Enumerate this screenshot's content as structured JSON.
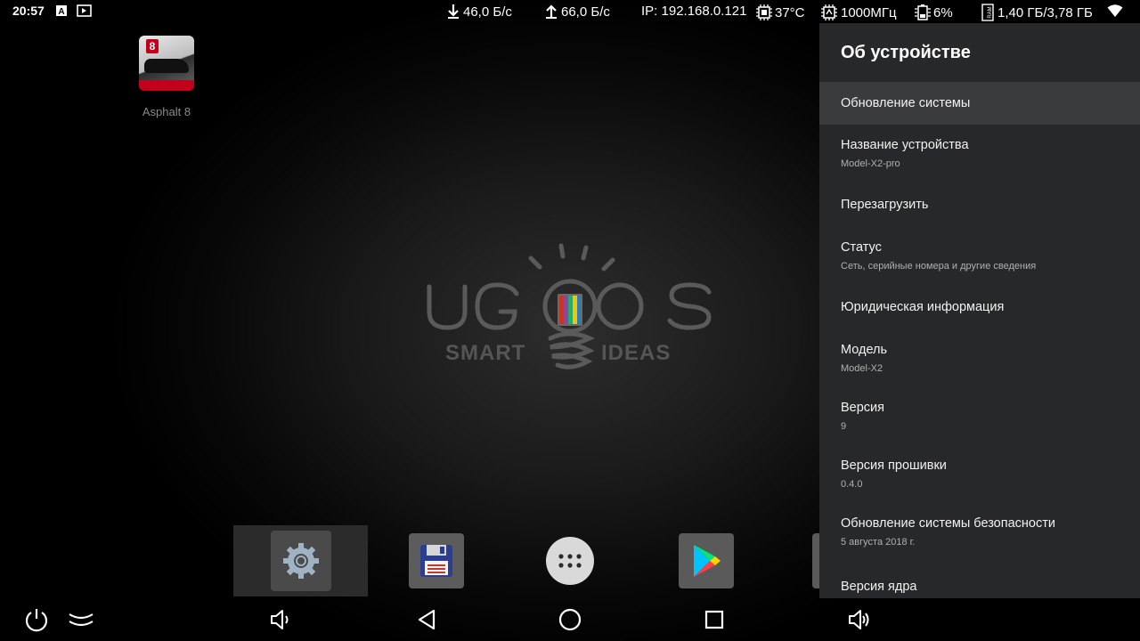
{
  "status_bar": {
    "time": "20:57",
    "download": "46,0 Б/с",
    "upload": "66,0 Б/с",
    "ip": "IP: 192.168.0.121",
    "cpu_temp": "37°C",
    "cpu_freq": "1000МГц",
    "cpu_load": "6%",
    "ram_label": "RAM",
    "ram": "1,40 ГБ/3,78 ГБ",
    "icons": [
      "notification-a-icon",
      "screencast-icon",
      "download-arrow-icon",
      "upload-arrow-icon",
      "cpu-chip-icon",
      "cpu-freq-icon",
      "battery-icon",
      "ram-icon",
      "wifi-icon"
    ]
  },
  "desktop": {
    "apps": [
      {
        "name": "Asphalt 8",
        "badge": "8",
        "icon": "asphalt-8-icon"
      }
    ],
    "wallpaper_logo": {
      "brand": "UGOOS",
      "tagline_left": "SMART",
      "tagline_right": "IDEAS"
    }
  },
  "dock": {
    "items": [
      {
        "icon": "settings-gear-icon",
        "selected": true
      },
      {
        "icon": "floppy-disk-icon"
      },
      {
        "icon": "app-drawer-icon"
      },
      {
        "icon": "play-store-icon"
      },
      {
        "icon": "partial-app-icon"
      }
    ]
  },
  "navbar": {
    "buttons": [
      "power-icon",
      "collapse-icon",
      "volume-down-icon",
      "back-icon",
      "home-icon",
      "recents-icon",
      "volume-up-icon"
    ]
  },
  "settings_panel": {
    "title": "Об устройстве",
    "items": [
      {
        "title": "Обновление системы",
        "subtitle": ""
      },
      {
        "title": "Название устройства",
        "subtitle": "Model-X2-pro"
      },
      {
        "title": "Перезагрузить",
        "subtitle": ""
      },
      {
        "title": "Статус",
        "subtitle": "Сеть, серийные номера и другие сведения"
      },
      {
        "title": "Юридическая информация",
        "subtitle": ""
      },
      {
        "title": "Модель",
        "subtitle": "Model-X2"
      },
      {
        "title": "Версия",
        "subtitle": "9"
      },
      {
        "title": "Версия прошивки",
        "subtitle": "0.4.0"
      },
      {
        "title": "Обновление системы безопасности",
        "subtitle": "5 августа 2018 г."
      },
      {
        "title": "Версия ядра",
        "subtitle": ""
      }
    ]
  },
  "colors": {
    "panel_bg": "#272829",
    "panel_active": "#3a3b3c",
    "badge_red": "#c3001b"
  }
}
